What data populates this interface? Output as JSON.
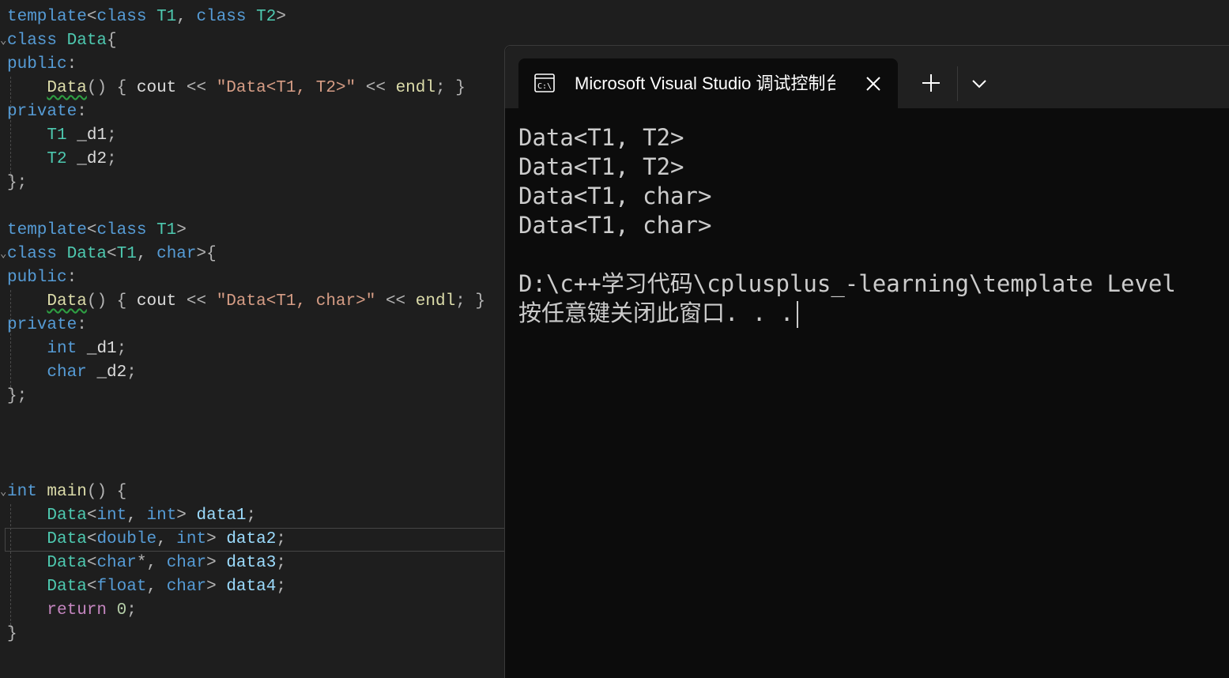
{
  "editor": {
    "lines": [
      "template<class T1, class T2>",
      "class Data{",
      "public:",
      "    Data() { cout << \"Data<T1, T2>\" << endl; }",
      "private:",
      "    T1 _d1;",
      "    T2 _d2;",
      "};",
      "",
      "template<class T1>",
      "class Data<T1, char>{",
      "public:",
      "    Data() { cout << \"Data<T1, char>\" << endl; }",
      "private:",
      "    int _d1;",
      "    char _d2;",
      "};",
      "",
      "",
      "",
      "int main() {",
      "    Data<int, int> data1;",
      "    Data<double, int> data2;",
      "    Data<char*, char> data3;",
      "    Data<float, char> data4;",
      "    return 0;",
      "}"
    ]
  },
  "terminal": {
    "tab_title": "Microsoft Visual Studio 调试控制台",
    "tab_icon": "console-icon",
    "close_icon": "close-icon",
    "new_tab_icon": "plus-icon",
    "dropdown_icon": "chevron-down-icon",
    "output": [
      "Data<T1, T2>",
      "Data<T1, T2>",
      "Data<T1, char>",
      "Data<T1, char>",
      "",
      "D:\\c++学习代码\\cplusplus_-learning\\template Level",
      "按任意键关闭此窗口. . ."
    ]
  },
  "colors": {
    "editor_bg": "#1e1e1e",
    "terminal_bg": "#0c0c0c",
    "tabbar_bg": "#202020",
    "keyword": "#569cd6",
    "type": "#4ec9b0",
    "string": "#d69d85"
  }
}
